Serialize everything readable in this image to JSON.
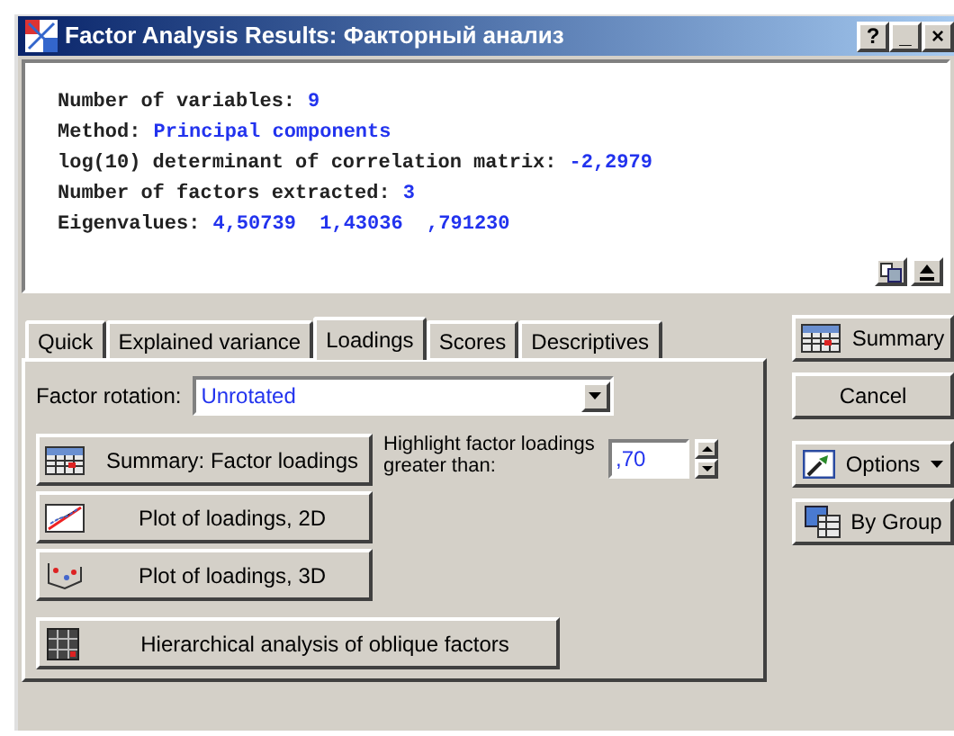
{
  "window": {
    "title": "Factor Analysis Results: Факторный анализ",
    "controls": [
      "?",
      "_",
      "×"
    ]
  },
  "results": [
    {
      "label": "Number of variables:",
      "value": "9"
    },
    {
      "label": "Method:",
      "value": "Principal components"
    },
    {
      "label": "log(10) determinant of correlation matrix:",
      "value": "-2,2979"
    },
    {
      "label": "Number of factors extracted:",
      "value": "3"
    },
    {
      "label": "Eigenvalues:",
      "value": "4,50739  1,43036  ,791230"
    }
  ],
  "tabs": [
    {
      "label": "Quick",
      "selected": false
    },
    {
      "label": "Explained variance",
      "selected": false
    },
    {
      "label": "Loadings",
      "selected": true
    },
    {
      "label": "Scores",
      "selected": false
    },
    {
      "label": "Descriptives",
      "selected": false
    }
  ],
  "factor_rotation": {
    "label": "Factor rotation:",
    "value": "Unrotated"
  },
  "highlight": {
    "label": "Highlight factor loadings greater than:",
    "value": ",70"
  },
  "actions": [
    {
      "label": "Summary: Factor loadings",
      "kind": "table"
    },
    {
      "label": "Plot of loadings, 2D",
      "kind": "plot2d"
    },
    {
      "label": "Plot of loadings, 3D",
      "kind": "plot3d"
    },
    {
      "label": "Hierarchical analysis of oblique factors",
      "kind": "tree"
    }
  ],
  "side_buttons": [
    {
      "label": "Summary",
      "kind": "table"
    },
    {
      "label": "Cancel",
      "kind": "plain"
    },
    {
      "label": "Options",
      "kind": "menu"
    },
    {
      "label": "By Group",
      "kind": "group"
    }
  ]
}
